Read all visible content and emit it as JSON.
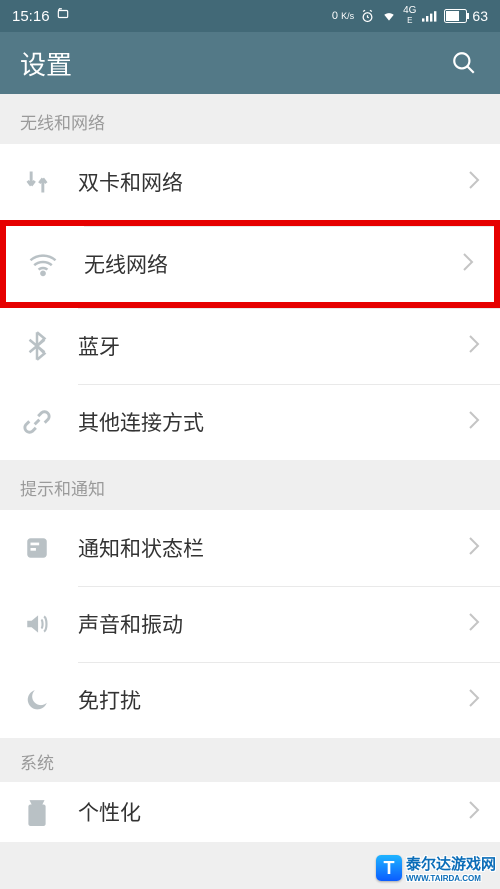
{
  "statusbar": {
    "time": "15:16",
    "network_rate": "0",
    "network_unit": "K/s",
    "net_label_top": "4G",
    "net_label_bottom": "E",
    "battery": "63"
  },
  "header": {
    "title": "设置"
  },
  "sections": {
    "wireless": "无线和网络",
    "notify": "提示和通知",
    "system": "系统"
  },
  "items": {
    "sim": "双卡和网络",
    "wifi": "无线网络",
    "bluetooth": "蓝牙",
    "other_conn": "其他连接方式",
    "notification": "通知和状态栏",
    "sound": "声音和振动",
    "dnd": "免打扰",
    "personalize": "个性化"
  },
  "watermark": {
    "logo": "T",
    "text": "泰尔达游戏网",
    "url": "WWW.TAIRDA.COM"
  }
}
